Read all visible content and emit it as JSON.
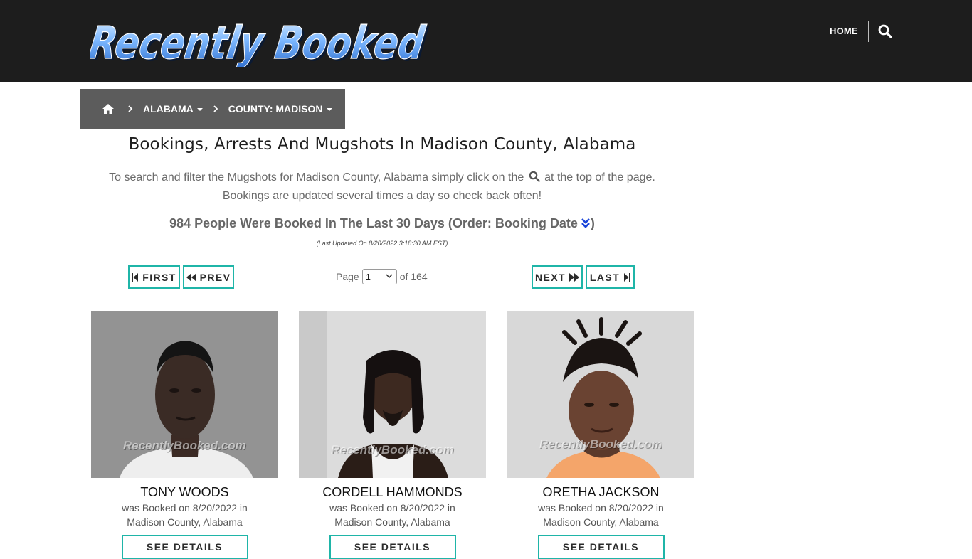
{
  "header": {
    "logo_text": "Recently Booked",
    "nav_home": "HOME",
    "search_icon": "search-icon"
  },
  "breadcrumb": {
    "home_icon": "home-icon",
    "state": "ALABAMA",
    "county": "COUNTY: MADISON"
  },
  "main": {
    "title": "Bookings, Arrests And Mugshots In Madison County, Alabama",
    "intro_part1": "To search and filter the Mugshots for Madison County, Alabama simply click on the",
    "intro_part2": "at the top of the page.",
    "intro_line2": "Bookings are updated several times a day so check back often!",
    "count_text": "984 People Were Booked In The Last 30 Days (Order: Booking Date",
    "count_close": ")",
    "last_updated": "(Last Updated On 8/20/2022 3:18:30 AM EST)"
  },
  "pager": {
    "first": "FIRST",
    "prev": "PREV",
    "page_label": "Page",
    "page_value": "1",
    "of_label": "of 164",
    "next": "NEXT",
    "last": "LAST"
  },
  "cards": [
    {
      "name": "TONY WOODS",
      "line1": "was Booked on 8/20/2022 in",
      "line2": "Madison County, Alabama",
      "button": "SEE DETAILS",
      "watermark": "RecentlyBooked.com"
    },
    {
      "name": "CORDELL HAMMONDS",
      "line1": "was Booked on 8/20/2022 in",
      "line2": "Madison County, Alabama",
      "button": "SEE DETAILS",
      "watermark": "RecentlyBooked.com"
    },
    {
      "name": "ORETHA JACKSON",
      "line1": "was Booked on 8/20/2022 in",
      "line2": "Madison County, Alabama",
      "button": "SEE DETAILS",
      "watermark": "RecentlyBooked.com"
    }
  ],
  "colors": {
    "header_bg": "#1d1d1d",
    "breadcrumb_bg": "#5c5c5c",
    "accent_teal": "#1fb5a8",
    "logo_blue": "#5aa8ff"
  }
}
